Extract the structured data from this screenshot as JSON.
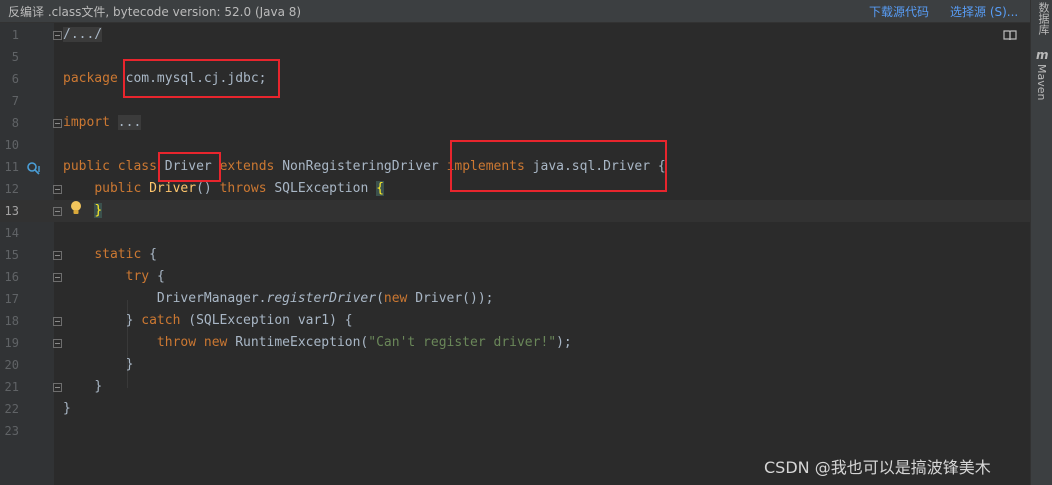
{
  "notification": {
    "message": "反编译 .class文件, bytecode version: 52.0 (Java 8)",
    "download_link": "下载源代码",
    "choose_link": "选择源 (S)..."
  },
  "right_panel": {
    "database_label": "数据库",
    "maven_icon_glyph": "m",
    "maven_label": "Maven"
  },
  "editor": {
    "lines": {
      "l1": "1",
      "l5": "5",
      "l6": "6",
      "l7": "7",
      "l8": "8",
      "l10": "10",
      "l11": "11",
      "l12": "12",
      "l13": "13",
      "l14": "14",
      "l15": "15",
      "l16": "16",
      "l17": "17",
      "l18": "18",
      "l19": "19",
      "l20": "20",
      "l21": "21",
      "l22": "22",
      "l23": "23"
    },
    "tokens": {
      "l1_fold": "/.../",
      "package_kw": "package",
      "package_name": "com.mysql.cj.jdbc;",
      "import_kw": "import",
      "import_fold": "...",
      "public_kw": "public",
      "class_kw": "class",
      "class_name": "Driver",
      "extends_kw": "extends",
      "super_class": "NonRegisteringDriver",
      "implements_kw": "implements",
      "interface_name": "java.sql.Driver",
      "open_brace": "{",
      "ctor_public": "public",
      "ctor_name": "Driver",
      "ctor_parens": "()",
      "throws_kw": "throws",
      "exception_type": "SQLException",
      "ctor_brace": "{",
      "close_brace": "}",
      "static_kw": "static",
      "static_brace": "{",
      "try_kw": "try",
      "try_brace": "{",
      "dm_class": "DriverManager.",
      "register_method": "registerDriver",
      "paren_open": "(",
      "new_kw": "new",
      "driver_new": "Driver());",
      "catch_close": "}",
      "catch_kw": "catch",
      "catch_params": "(SQLException var1) {",
      "throw_kw": "throw",
      "new_kw2": "new",
      "runtime_ex": "RuntimeException(",
      "err_string": "\"Can't register driver!\"",
      "err_end": ");",
      "close19": "}",
      "close20": "}",
      "close21": "}"
    }
  },
  "watermark": "CSDN @我也可以是搞波锋美木"
}
